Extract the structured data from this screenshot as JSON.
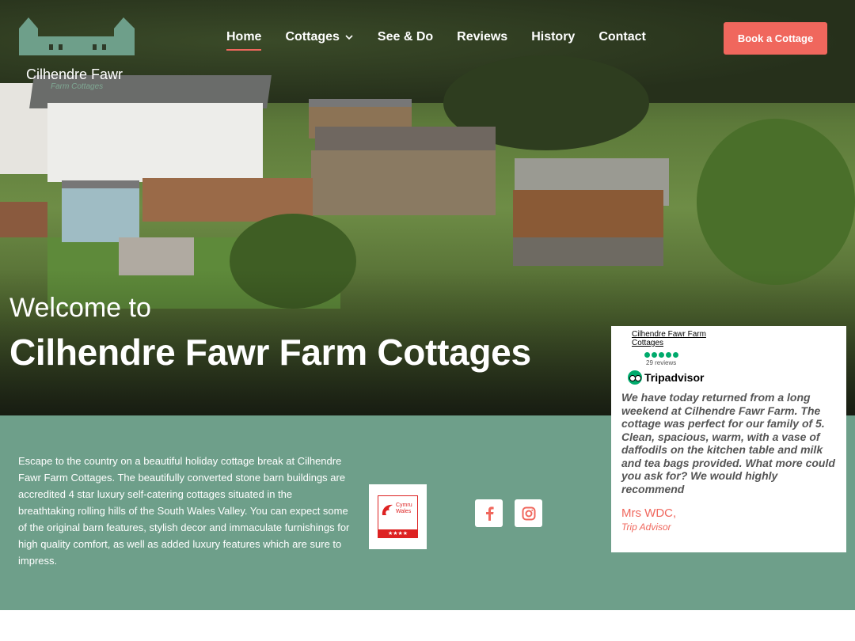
{
  "logo": {
    "name": "Cilhendre Fawr",
    "sub": "Farm Cottages"
  },
  "nav": {
    "items": [
      {
        "label": "Home"
      },
      {
        "label": "Cottages"
      },
      {
        "label": "See & Do"
      },
      {
        "label": "Reviews"
      },
      {
        "label": "History"
      },
      {
        "label": "Contact"
      }
    ],
    "book_label": "Book a Cottage"
  },
  "hero": {
    "welcome": "Welcome to",
    "headline": "Cilhendre Fawr Farm Cottages"
  },
  "intro": {
    "text": "Escape to the country on a beautiful holiday cottage break at Cilhendre Fawr Farm Cottages. The beautifully converted stone barn buildings are accredited 4 star luxury self-catering cottages situated in the breathtaking rolling hills of the South Wales Valley.  You can expect some of the original barn features, stylish decor and immaculate furnishings for high quality comfort, as well as added luxury features which are sure to impress."
  },
  "badge": {
    "line1": "Cymru",
    "line2": "Wales",
    "stars": "★★★★"
  },
  "social": {
    "facebook_icon": "facebook-icon",
    "instagram_icon": "instagram-icon"
  },
  "review": {
    "ta_name": "Cilhendre Fawr Farm Cottages",
    "ta_count": "29 reviews",
    "ta_brand": "Tripadvisor",
    "quote": "We have today returned from a long weekend at Cilhendre Fawr Farm. The cottage was perfect for our family of 5. Clean, spacious, warm, with a vase of daffodils on the kitchen table and milk and tea bags provided. What more could you ask for? We would highly recommend",
    "author": "Mrs WDC,",
    "source": "Trip Advisor"
  },
  "colors": {
    "accent": "#f0675d",
    "band": "#6e9f8a",
    "tripadvisor": "#00aa6c"
  }
}
